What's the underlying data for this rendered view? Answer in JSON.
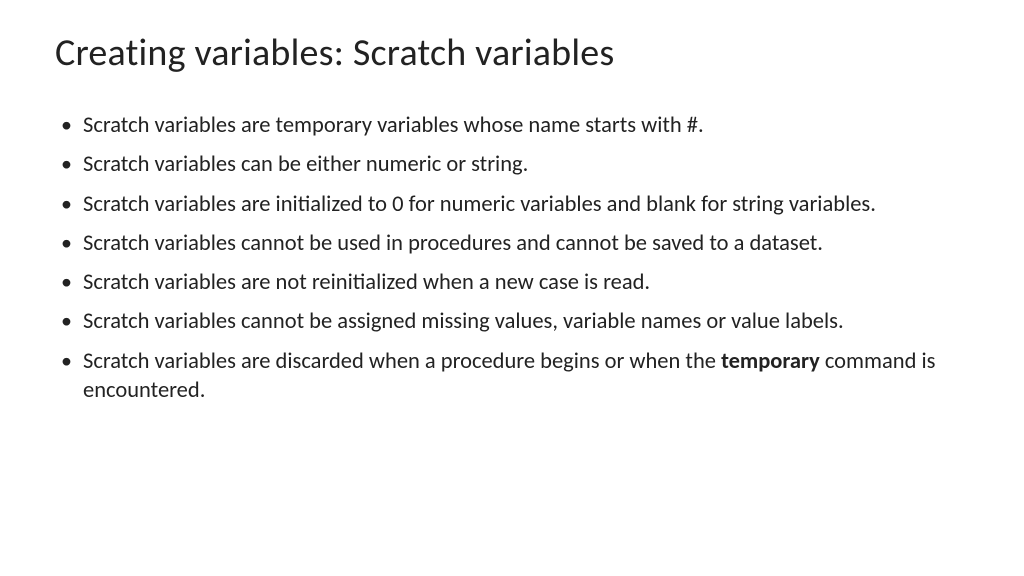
{
  "slide": {
    "title": "Creating variables: Scratch variables",
    "bullets": [
      {
        "text": "Scratch variables are temporary variables whose name starts with #."
      },
      {
        "text": "Scratch variables can be either numeric or string."
      },
      {
        "text": "Scratch variables are initialized to 0 for numeric variables and blank for string variables."
      },
      {
        "text": "Scratch variables cannot be used in procedures and cannot be saved to a dataset."
      },
      {
        "text": "Scratch variables are not reinitialized when a new case is read."
      },
      {
        "text": "Scratch variables cannot be assigned missing values, variable names or value labels."
      },
      {
        "text_pre": "Scratch variables are discarded when a procedure begins or when the ",
        "bold": "temporary",
        "text_post": " command is encountered."
      }
    ]
  }
}
